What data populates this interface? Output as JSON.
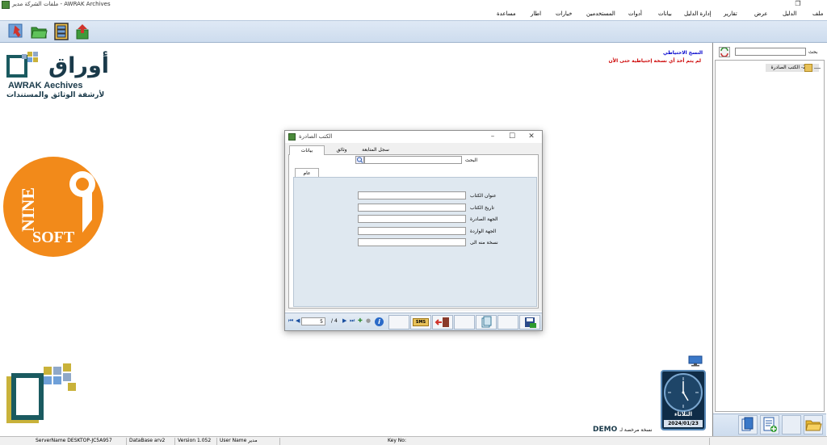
{
  "window": {
    "title": "ملفات الشركة  مدير - AWRAK Archives",
    "restore_glyph": "❐"
  },
  "menu": [
    "ملف",
    "الدليل",
    "عرض",
    "تقارير",
    "إدارة الدليل",
    "بيانات",
    "أدوات",
    "المستخدمين",
    "خيارات",
    "اطار",
    "مساعدة"
  ],
  "toolbar": {
    "buttons": [
      "exit-icon",
      "open-folder-icon",
      "cabinet-icon",
      "export-icon"
    ]
  },
  "logo": {
    "arabic": "أوراق",
    "english": "AWRAK Aechives",
    "tagline": "لأرشفة الوثائق والمستندات"
  },
  "nine_soft": {
    "top": "NINE",
    "digit": "9",
    "bottom": "SOFT"
  },
  "backup": {
    "title": "النسخ الاحتياطي",
    "message": "لم يتم أخذ أي نسخة إحتياطية حتى الأن"
  },
  "right_panel": {
    "search_label": "بحث",
    "search_value": "",
    "tree_items": [
      "2- الكتب الصادرة"
    ]
  },
  "dialog": {
    "title": "الكتب الصادرة",
    "tabs": [
      "بيانات",
      "وثائق",
      "سجل المتابعة"
    ],
    "search_label": "البحث",
    "inner_tab": "عام",
    "fields": [
      {
        "label": "عنوان الكتاب",
        "value": ""
      },
      {
        "label": "تاريخ الكتاب",
        "value": ""
      },
      {
        "label": "الجهة الصادرة",
        "value": ""
      },
      {
        "label": "الجهة الواردة",
        "value": ""
      },
      {
        "label": "نسخة منه الى",
        "value": ""
      }
    ],
    "nav": {
      "current": "5",
      "total": "4",
      "separator": "/"
    },
    "sms_label": "SMS"
  },
  "clock": {
    "day": "الثلاثاء",
    "date": "2024/01/23"
  },
  "demo": {
    "label": "DEMO",
    "text": "نسخة مرخصة لـ"
  },
  "status": {
    "server": "ServerName  DESKTOP-JC5A957",
    "database": "DataBase  arv2",
    "version": "Version  1.052",
    "user": "User Name  مدير",
    "key": "Key No:"
  }
}
